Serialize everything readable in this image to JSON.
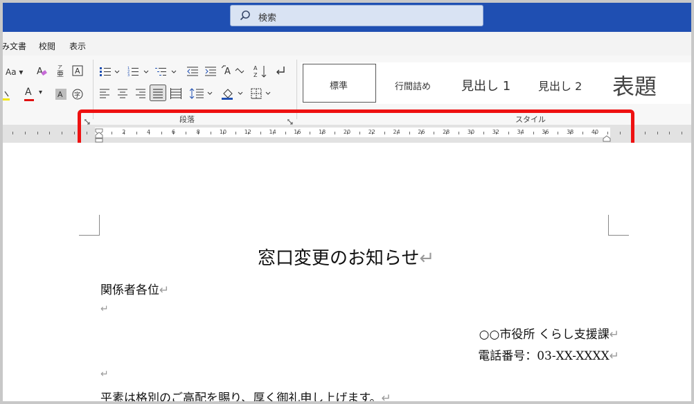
{
  "search": {
    "placeholder": "検索"
  },
  "menu": {
    "tabs": [
      "み文書",
      "校閲",
      "表示"
    ]
  },
  "ribbon": {
    "font_size_label": "Aa",
    "font_color_label": "A",
    "group_paragraph": "段落",
    "group_styles": "スタイル",
    "styles": [
      "標準",
      "行間詰め",
      "見出し 1",
      "見出し 2",
      "表題"
    ]
  },
  "ruler": {
    "numbers": [
      "2",
      "4",
      "6",
      "8",
      "10",
      "12",
      "14",
      "16",
      "18",
      "20",
      "22",
      "24",
      "26",
      "28",
      "30",
      "32",
      "34",
      "36",
      "38",
      "40"
    ]
  },
  "document": {
    "title": "窓口変更のお知らせ",
    "salutation": "関係者各位",
    "sender": "○○市役所 くらし支援課",
    "phone": "電話番号：03-XX-XXXX",
    "body_line1": "平素は格別のご高配を賜り、厚く御礼申し上げます。",
    "paragraph_mark": "↵"
  },
  "colors": {
    "title_bar": "#1f4fb2",
    "highlight": "#ee1111",
    "font_color_underline": "#e01010",
    "highlight_underline": "#f2e600"
  }
}
